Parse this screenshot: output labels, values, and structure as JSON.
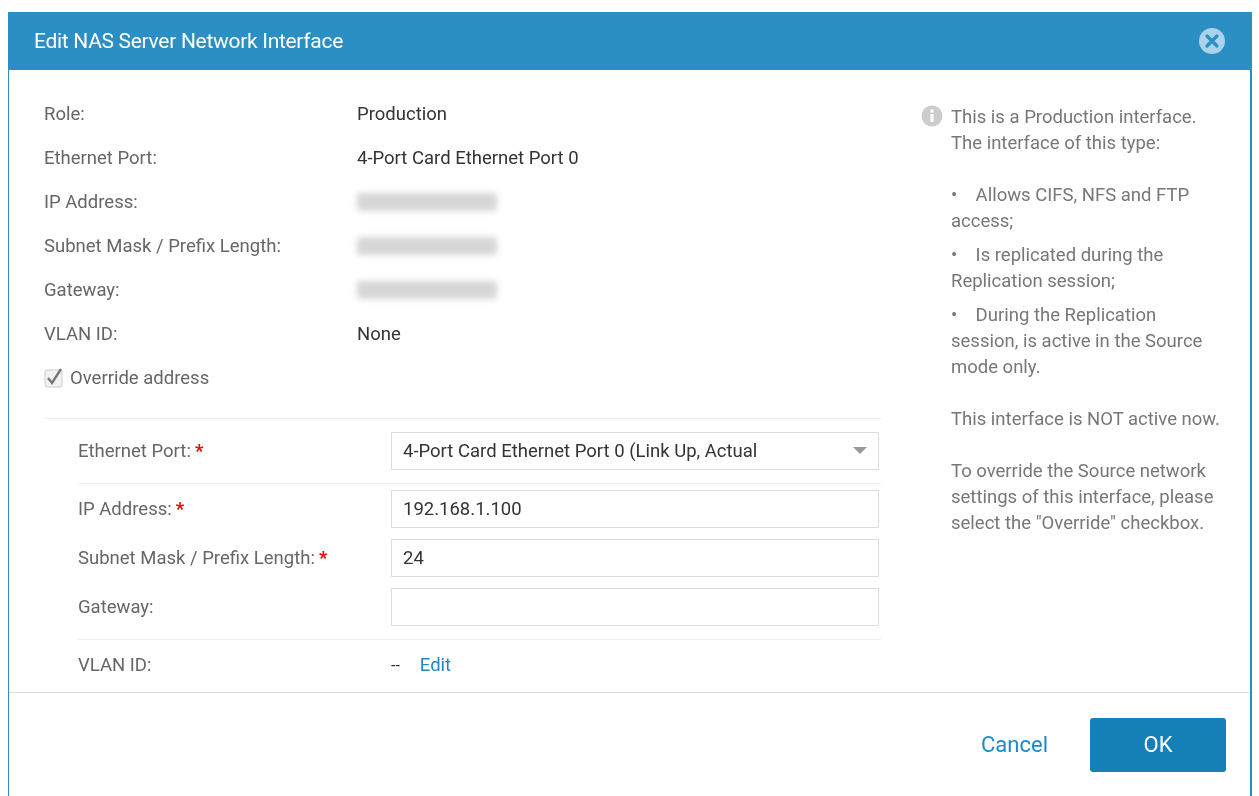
{
  "dialog": {
    "title": "Edit NAS Server Network Interface"
  },
  "details": [
    {
      "label": "Role:",
      "value": "Production"
    },
    {
      "label": "Ethernet Port:",
      "value": "4-Port Card Ethernet Port 0"
    },
    {
      "label": "IP Address:"
    },
    {
      "label": "Subnet Mask / Prefix Length:"
    },
    {
      "label": "Gateway:"
    },
    {
      "label": "VLAN ID:",
      "value": "None"
    }
  ],
  "override": {
    "label": "Override address",
    "checked": true
  },
  "form": [
    {
      "kind": "dropdown",
      "label": "Ethernet Port:",
      "required_mark": "*",
      "value": "4-Port Card Ethernet Port 0 (Link Up, Actual"
    },
    {
      "kind": "input",
      "label": "IP Address:",
      "required_mark": "*",
      "value": "192.168.1.100"
    },
    {
      "kind": "input",
      "label": "Subnet Mask / Prefix Length:",
      "required_mark": "*",
      "value": "24"
    },
    {
      "kind": "input",
      "label": "Gateway:"
    },
    {
      "kind": "link",
      "label": "VLAN ID:",
      "value": "--",
      "link": "Edit"
    }
  ],
  "info": {
    "intro": "This is a Production interface. The interface of this type:",
    "bullets": [
      "•    Allows CIFS, NFS and FTP access;",
      "•    Is replicated during the Replication session;",
      "•    During the Replication session, is active in the Source mode only."
    ],
    "paragraphs": [
      "This interface is NOT active now.",
      "To override the Source network settings of this interface, please select the \"Override\" checkbox."
    ]
  },
  "buttons": {
    "cancel": "Cancel",
    "ok": "OK"
  }
}
